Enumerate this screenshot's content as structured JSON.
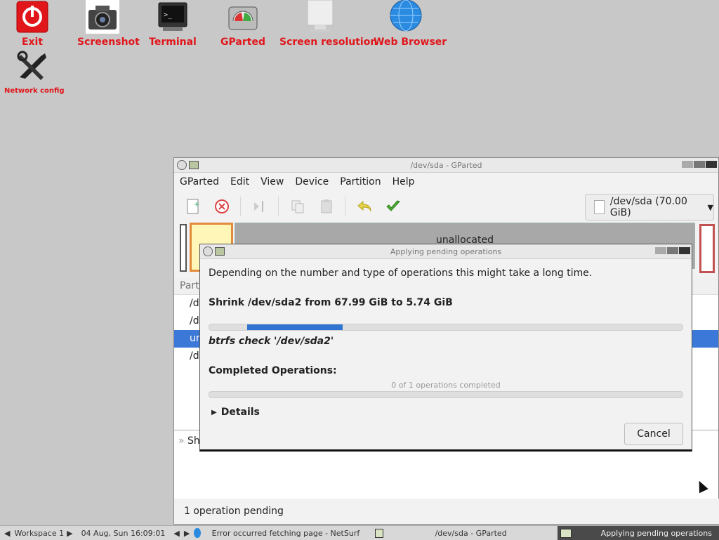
{
  "desktop": {
    "icons": [
      {
        "name": "exit",
        "label": "Exit"
      },
      {
        "name": "screenshot",
        "label": "Screenshot"
      },
      {
        "name": "terminal",
        "label": "Terminal"
      },
      {
        "name": "gparted",
        "label": "GParted"
      },
      {
        "name": "screen-resolution",
        "label": "Screen resolution"
      },
      {
        "name": "web-browser",
        "label": "Web Browser"
      },
      {
        "name": "network-config",
        "label": "Network config"
      }
    ]
  },
  "gparted": {
    "title": "/dev/sda - GParted",
    "menu": [
      "GParted",
      "Edit",
      "View",
      "Device",
      "Partition",
      "Help"
    ],
    "device": "/dev/sda (70.00 GiB)",
    "unallocated_label": "unallocated",
    "list_header": "Part",
    "rows": [
      "/d",
      "/d",
      "ur",
      "/d"
    ],
    "operation": "Sh",
    "status": "1 operation pending"
  },
  "dialog": {
    "title": "Applying pending operations",
    "message": "Depending on the number and type of operations this might take a long time.",
    "operation": "Shrink /dev/sda2 from 67.99 GiB to 5.74 GiB",
    "sub_operation": "btrfs check '/dev/sda2'",
    "completed_label": "Completed Operations:",
    "completed_count": "0 of 1 operations completed",
    "details_label": "Details",
    "cancel_label": "Cancel"
  },
  "taskbar": {
    "workspace": "Workspace 1",
    "datetime": "04 Aug, Sun 16:09:01",
    "tasks": [
      "Error occurred fetching page - NetSurf",
      "/dev/sda - GParted",
      "Applying pending operations"
    ]
  },
  "colors": {
    "accent": "#2f74d0",
    "desktop_label": "#e0161b",
    "selected_row": "#3c78d8"
  }
}
